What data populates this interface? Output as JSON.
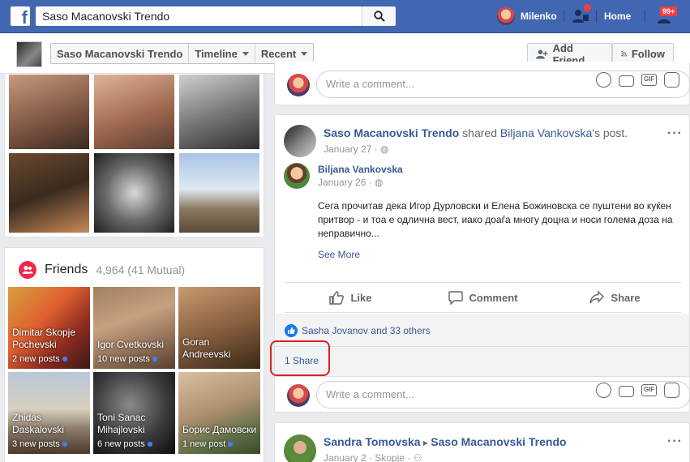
{
  "topbar": {
    "search_value": "Saso Macanovski Trendo",
    "user_name": "Milenko",
    "home_label": "Home",
    "notification_badge": "99+"
  },
  "profile_header": {
    "crumbs": [
      "Saso Macanovski Trendo",
      "Timeline",
      "Recent"
    ],
    "add_friend_label": "Add Friend",
    "follow_label": "Follow"
  },
  "friends": {
    "title": "Friends",
    "count": "4,964 (41 Mutual)",
    "tiles": [
      {
        "name": "Dimitar Skopje Pochevski",
        "posts": "2 new posts"
      },
      {
        "name": "Igor Cvetkovski",
        "posts": "10 new posts"
      },
      {
        "name": "Goran Andreevski",
        "posts": ""
      },
      {
        "name": "Zhidas Daskalovski",
        "posts": "3 new posts"
      },
      {
        "name": "Toni Sanac Mihajlovski",
        "posts": "6 new posts"
      },
      {
        "name": "Борис Дамовски",
        "posts": "1 new post"
      }
    ]
  },
  "comment_placeholder": "Write a comment...",
  "post1": {
    "author": "Saso Macanovski Trendo",
    "shared_text": " shared ",
    "original_author_link": "Biljana Vankovska",
    "post_suffix": "'s post.",
    "date": "January 27 · ",
    "inner_author": "Biljana Vankovska",
    "inner_date": "January 26 · ",
    "body": "Сега прочитав дека Игор Дурловски и Елена Божиновска се пуштени во куќен притвор - и тоа е одлична вест, иако доаѓа многу доцна и носи голема доза на неправично...",
    "see_more": "See More",
    "actions": [
      "Like",
      "Comment",
      "Share"
    ],
    "reactions_text": "Sasha Jovanov and 33 others",
    "shares_text": "1 Share"
  },
  "post2": {
    "author": "Sandra Tomovska",
    "arrow": "▸",
    "target": "Saso Macanovski Trendo",
    "date": "January 2 · Skopje · "
  },
  "colors": {
    "brand_blue": "#4267b2",
    "link_blue": "#385898",
    "notification_red": "#fa3e3e",
    "friends_pink": "#f02849"
  }
}
